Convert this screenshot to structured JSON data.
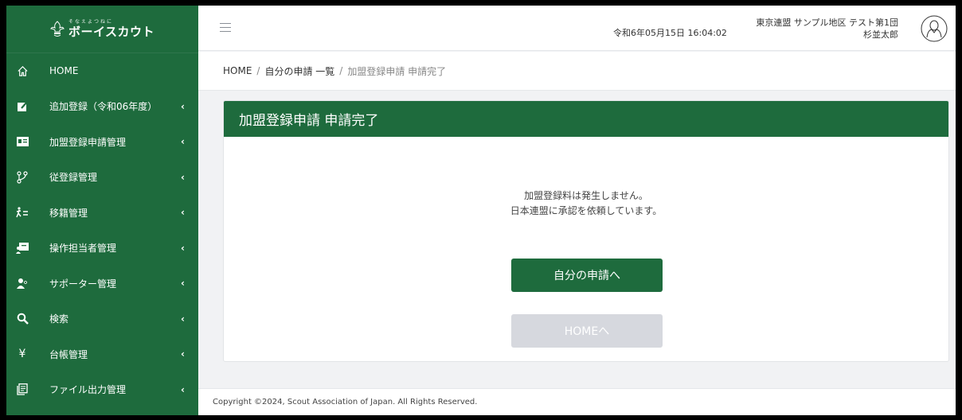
{
  "sidebar": {
    "logo": {
      "sub": "そなえよつねに",
      "main": "ボーイスカウト"
    },
    "items": [
      {
        "label": "HOME",
        "icon": "home-icon",
        "chevron": ""
      },
      {
        "label": "追加登録（令和06年度）",
        "icon": "edit-icon",
        "chevron": "‹"
      },
      {
        "label": "加盟登録申請管理",
        "icon": "id-card-icon",
        "chevron": "‹"
      },
      {
        "label": "従登録管理",
        "icon": "branch-icon",
        "chevron": "‹"
      },
      {
        "label": "移籍管理",
        "icon": "transfer-icon",
        "chevron": "‹"
      },
      {
        "label": "操作担当者管理",
        "icon": "operator-icon",
        "chevron": "‹"
      },
      {
        "label": "サポーター管理",
        "icon": "supporter-icon",
        "chevron": "‹"
      },
      {
        "label": "検索",
        "icon": "search-icon",
        "chevron": "‹"
      },
      {
        "label": "台帳管理",
        "icon": "yen-icon",
        "chevron": "‹"
      },
      {
        "label": "ファイル出力管理",
        "icon": "file-export-icon",
        "chevron": "‹"
      }
    ]
  },
  "header": {
    "datetime": "令和6年05月15日 16:04:02",
    "org": "東京連盟 サンプル地区 テスト第1団",
    "user": "杉並太郎"
  },
  "breadcrumb": {
    "home": "HOME",
    "sep": "/",
    "list": "自分の申請 一覧",
    "current": "加盟登録申請 申請完了"
  },
  "card": {
    "title": "加盟登録申請 申請完了",
    "message_line1": "加盟登録料は発生しません。",
    "message_line2": "日本連盟に承認を依頼しています。",
    "primary_button": "自分の申請へ",
    "secondary_button": "HOMEへ"
  },
  "footer": {
    "copyright": "Copyright ©2024, Scout Association of Japan. All Rights Reserved."
  },
  "colors": {
    "brand_green": "#1e6b3d",
    "disabled_button": "#d6d8de",
    "background": "#f1f2f4"
  }
}
